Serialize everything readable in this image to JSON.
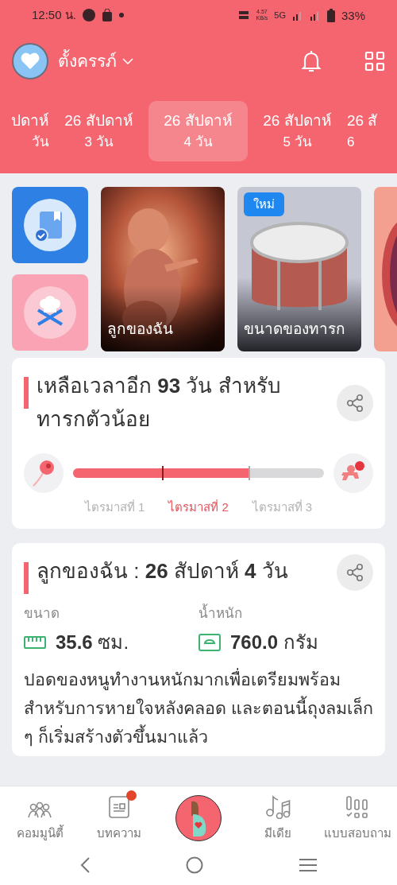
{
  "status_bar": {
    "time": "12:50 น.",
    "speed_value": "4.57",
    "speed_unit": "KB/s",
    "network": "5G",
    "battery": "33%"
  },
  "header": {
    "title": "ตั้งครรภ์"
  },
  "day_tabs": [
    {
      "week": "ปดาห์",
      "day": "วัน",
      "selected": false
    },
    {
      "week": "26 สัปดาห์",
      "day": "3 วัน",
      "selected": false
    },
    {
      "week": "26 สัปดาห์",
      "day": "4 วัน",
      "selected": true
    },
    {
      "week": "26 สัปดาห์",
      "day": "5 วัน",
      "selected": false
    },
    {
      "week": "26 สั",
      "day": "6",
      "selected": false
    }
  ],
  "quick_tiles": [
    {
      "kind": "journal",
      "color": "#2f80e4"
    },
    {
      "kind": "recipes",
      "color": "#f9a3b4"
    }
  ],
  "feature_cards": [
    {
      "kind": "fetus",
      "title": "ลูกของฉัน"
    },
    {
      "kind": "drum",
      "title": "ขนาดของทารก",
      "badge": "ใหม่"
    },
    {
      "kind": "partial"
    }
  ],
  "countdown": {
    "title": "เหลือเวลาอีก **93** วัน สำหรับทารกตัวน้อย",
    "progress": {
      "level": 0.7
    },
    "trimesters": [
      {
        "label": "ไตรมาสที่ 1",
        "selected": false
      },
      {
        "label": "ไตรมาสที่ 2",
        "selected": true
      },
      {
        "label": "ไตรมาสที่ 3",
        "selected": false
      }
    ]
  },
  "baby": {
    "title": "ลูกของฉัน : **26** สัปดาห์ **4**  วัน",
    "stats": [
      {
        "kind": "size",
        "label": "ขนาด",
        "value": "**35.6** ซม."
      },
      {
        "kind": "weight",
        "label": "น้ำหนัก",
        "value": "**760.0** กรัม"
      }
    ],
    "description": "ปอดของหนูทำงานหนักมากเพื่อเตรียมพร้อมสำหรับการหายใจหลังคลอด และตอนนี้ถุงลมเล็ก ๆ ก็เริ่มสร้างตัวขึ้นมาแล้ว"
  },
  "bottom_nav": [
    {
      "kind": "community",
      "label": "คอมมูนิตี้",
      "has_dot": false
    },
    {
      "kind": "articles",
      "label": "บทความ",
      "has_dot": true
    },
    {
      "kind": "home"
    },
    {
      "kind": "media",
      "label": "มีเดีย",
      "has_dot": false
    },
    {
      "kind": "quiz",
      "label": "แบบสอบถาม",
      "has_dot": false
    }
  ]
}
